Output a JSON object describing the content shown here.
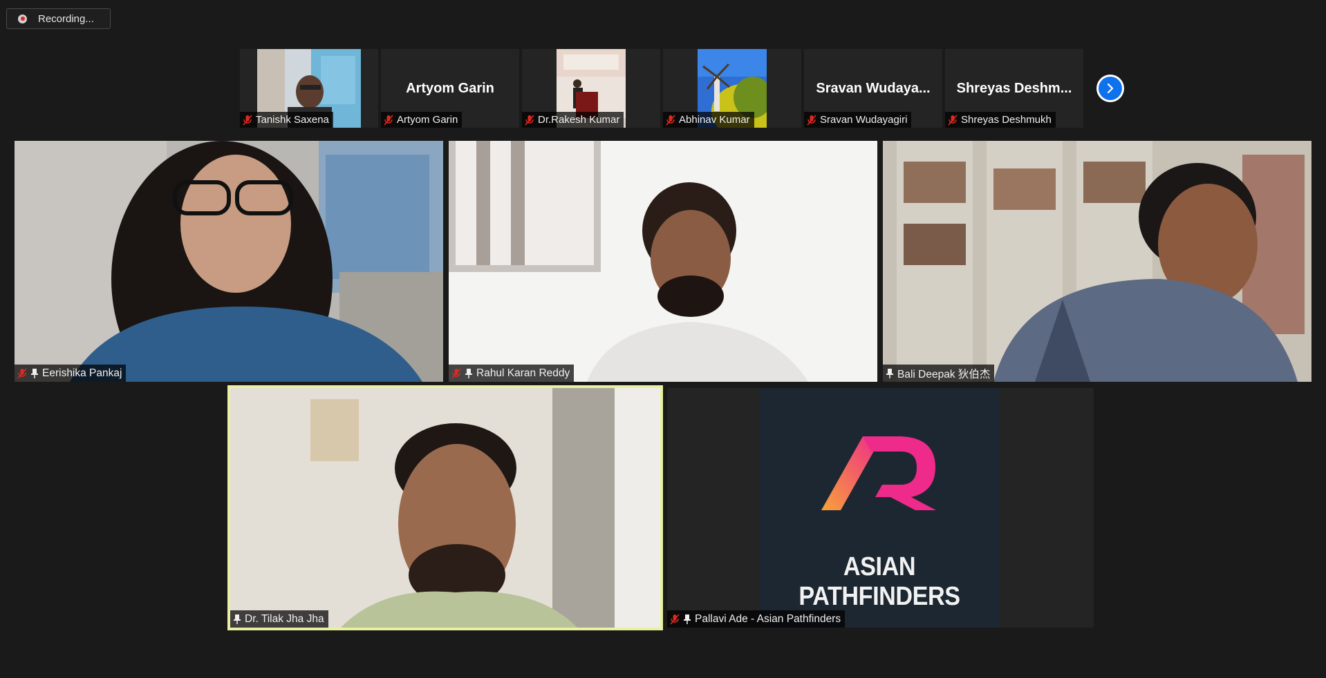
{
  "recording": {
    "label": "Recording..."
  },
  "thumbnails": [
    {
      "name": "Tanishk Saxena",
      "display": "",
      "muted": true
    },
    {
      "name": "Artyom Garin",
      "display": "Artyom Garin",
      "muted": true
    },
    {
      "name": "Dr.Rakesh Kumar",
      "display": "",
      "muted": true
    },
    {
      "name": "Abhinav Kumar",
      "display": "",
      "muted": true
    },
    {
      "name": "Sravan Wudayagiri",
      "display": "Sravan  Wudaya...",
      "muted": true
    },
    {
      "name": "Shreyas Deshmukh",
      "display": "Shreyas  Deshm...",
      "muted": true
    }
  ],
  "gallery": [
    {
      "name": "Eerishika Pankaj",
      "muted": true,
      "pinned": true
    },
    {
      "name": "Rahul Karan Reddy",
      "muted": true,
      "pinned": true
    },
    {
      "name": "Bali Deepak 狄伯杰",
      "muted": false,
      "pinned": true
    },
    {
      "name": "Dr. Tilak Jha Jha",
      "muted": false,
      "pinned": true,
      "active_speaker": true
    },
    {
      "name": "Pallavi Ade - Asian Pathfinders",
      "muted": true,
      "pinned": true
    }
  ],
  "logo": {
    "text": "ASIAN PATHFINDERS",
    "mark": "AR"
  },
  "colors": {
    "accent": "#0e72ed",
    "active_border": "#e9f0a0",
    "muted_icon": "#e0281e",
    "logo_bg": "#1d2731",
    "logo_pink": "#ee2a8a",
    "logo_orange": "#f7a23b"
  },
  "icons": [
    "record-icon",
    "mic-muted-icon",
    "pin-icon",
    "chevron-right-icon"
  ]
}
